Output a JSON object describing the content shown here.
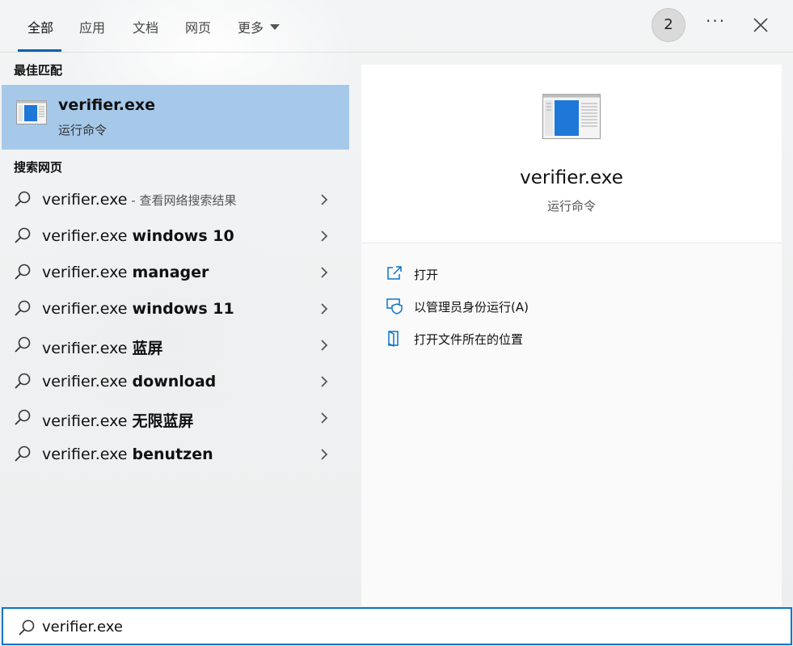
{
  "tabs": [
    {
      "label": "全部",
      "active": true
    },
    {
      "label": "应用"
    },
    {
      "label": "文档"
    },
    {
      "label": "网页"
    },
    {
      "label": "更多"
    }
  ],
  "header": {
    "badge_count": "2",
    "more_options": "···"
  },
  "best_match": {
    "section_title": "最佳匹配",
    "name": "verifier.exe",
    "subtitle": "运行命令"
  },
  "web_search": {
    "section_title": "搜索网页",
    "items": [
      {
        "query": "verifier.exe",
        "suffix": "",
        "hint": " - 查看网络搜索结果"
      },
      {
        "query": "verifier.exe ",
        "suffix": "windows 10",
        "hint": ""
      },
      {
        "query": "verifier.exe ",
        "suffix": "manager",
        "hint": ""
      },
      {
        "query": "verifier.exe ",
        "suffix": "windows 11",
        "hint": ""
      },
      {
        "query": "verifier.exe ",
        "suffix": "蓝屏",
        "hint": ""
      },
      {
        "query": "verifier.exe ",
        "suffix": "download",
        "hint": ""
      },
      {
        "query": "verifier.exe ",
        "suffix": "无限蓝屏",
        "hint": ""
      },
      {
        "query": "verifier.exe ",
        "suffix": "benutzen",
        "hint": ""
      }
    ]
  },
  "detail": {
    "name": "verifier.exe",
    "subtitle": "运行命令",
    "actions": [
      {
        "label": "打开",
        "icon": "open-icon"
      },
      {
        "label": "以管理员身份运行(A)",
        "icon": "admin-shield-icon"
      },
      {
        "label": "打开文件所在的位置",
        "icon": "file-location-icon"
      }
    ]
  },
  "search": {
    "value": "verifier.exe"
  },
  "colors": {
    "accent": "#0a74c9",
    "selected_bg": "#a6c9ea",
    "tab_underline": "#0063b1"
  }
}
